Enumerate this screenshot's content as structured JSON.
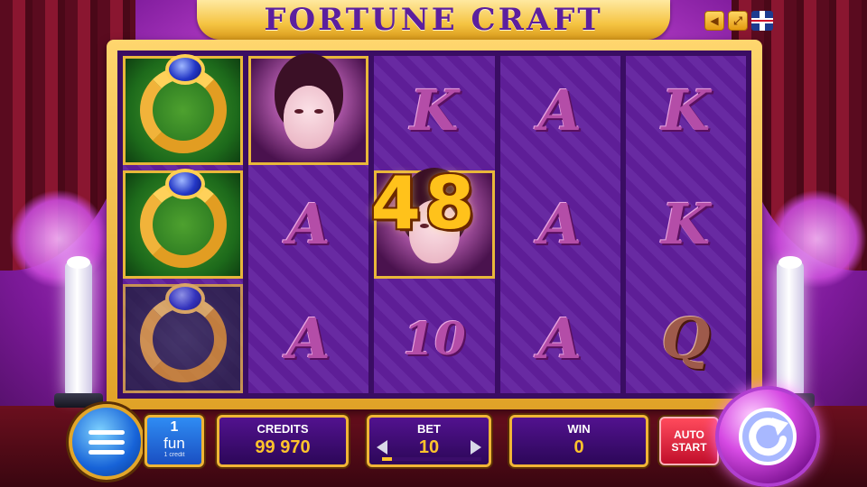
{
  "title": "FORTUNE CRAFT",
  "corner_icons": [
    "sound-icon",
    "fullscreen-icon",
    "language-flag-icon"
  ],
  "reels": [
    [
      "ring",
      "ring",
      "ring-dim"
    ],
    [
      "portrait",
      "A",
      "A"
    ],
    [
      "K",
      "portrait-partial",
      "10"
    ],
    [
      "A",
      "A",
      "A"
    ],
    [
      "K",
      "K",
      "Q"
    ]
  ],
  "win_amount_overlay": "48",
  "panel": {
    "fun": {
      "value": "1",
      "unit": "fun",
      "sub": "1 credit"
    },
    "credits": {
      "label": "CREDITS",
      "value": "99 970"
    },
    "bet": {
      "label": "BET",
      "value": "10",
      "level": 0.1
    },
    "win": {
      "label": "WIN",
      "value": "0"
    },
    "auto_start": {
      "line1": "AUTO",
      "line2": "START"
    }
  },
  "colors": {
    "reel_bg": "#5e1e97",
    "frame_gold": "#f0b536",
    "value_gold": "#ffc42b",
    "title_purple": "#5c1f9e",
    "auto_red": "#e0213a"
  }
}
